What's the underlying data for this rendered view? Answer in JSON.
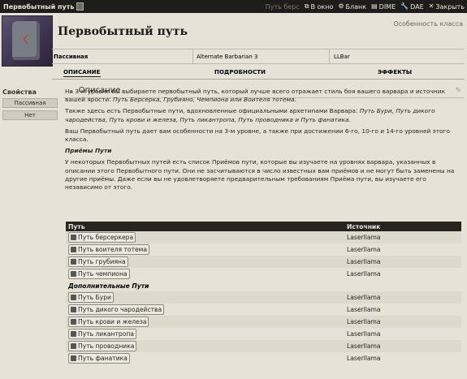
{
  "window": {
    "title": "Первобытный путь",
    "actions": [
      {
        "label": "Путь берс",
        "icon": "",
        "dim": true
      },
      {
        "label": "В окно",
        "icon": "popout-icon"
      },
      {
        "label": "Бланк",
        "icon": "gear-icon"
      },
      {
        "label": "DIME",
        "icon": "book-icon"
      },
      {
        "label": "DAE",
        "icon": "wrench-icon"
      },
      {
        "label": "Закрыть",
        "icon": "close-icon"
      }
    ]
  },
  "item": {
    "name": "Первобытный путь",
    "type": "Особенность класса",
    "summary": [
      "Пассивная",
      "Alternate Barbarian 3",
      "LLBar"
    ]
  },
  "tabs": [
    "ОПИСАНИЕ",
    "ПОДРОБНОСТИ",
    "ЭФФЕКТЫ"
  ],
  "sidebar": {
    "title": "Свойства",
    "pills": [
      "Пассивная",
      "Нет"
    ]
  },
  "description": {
    "header": "Описание",
    "p1_a": "На 3-м уровне вы выбираете первобытный путь, который лучше всего отражает стиль боя вашего варвара и источник вашей ярости: ",
    "p1_b": "Путь Берсерка, Грубияно, Чемпиона или Воителя тотема",
    "p1_c": ".",
    "p2_a": "Также здесь есть Первобытные пути, вдохновленные официальными архетипами Варвара: ",
    "p2_b": "Путь Бури, Путь дикого чародейства, Путь крови и железа, Путь ликантропа, Путь проводника и Путь фанатика",
    "p2_c": ".",
    "p3": "Ваш Первобытный путь дает вам особенности на 3-м уровне, а также при достижении 6-го, 10-го и 14-го уровней этого класса.",
    "h1": "Приёмы Пути",
    "p4": "У некоторых Первобытных путей есть список Приёмов пути, которые вы изучаете на уровнях варвара, указанных в описании этого Первобытного пути. Они не засчитываются в число известных вам приёмов и не могут быть заменены на другие приёмы. Даже если вы не удовлетворяете предварительным требованиям Приёма пути, вы изучаете его независимо от этого."
  },
  "table": {
    "headers": [
      "Путь",
      "Источник"
    ],
    "rows": [
      {
        "name": "Путь берсеркера",
        "source": "Laserllama"
      },
      {
        "name": "Путь воителя тотема",
        "source": "Laserllama"
      },
      {
        "name": "Путь грубияна",
        "source": "Laserllama"
      },
      {
        "name": "Путь чемпиона",
        "source": "Laserllama"
      }
    ],
    "subheader": "Дополнительные Пути",
    "rows2": [
      {
        "name": "Путь Бури",
        "source": "Laserllama"
      },
      {
        "name": "Путь дикого чародейства",
        "source": "Laserllama"
      },
      {
        "name": "Путь крови и железа",
        "source": "Laserllama"
      },
      {
        "name": "Путь ликантропа",
        "source": "Laserllama"
      },
      {
        "name": "Путь проводника",
        "source": "Laserllama"
      },
      {
        "name": "Путь фанатика",
        "source": "Laserllama"
      }
    ]
  }
}
